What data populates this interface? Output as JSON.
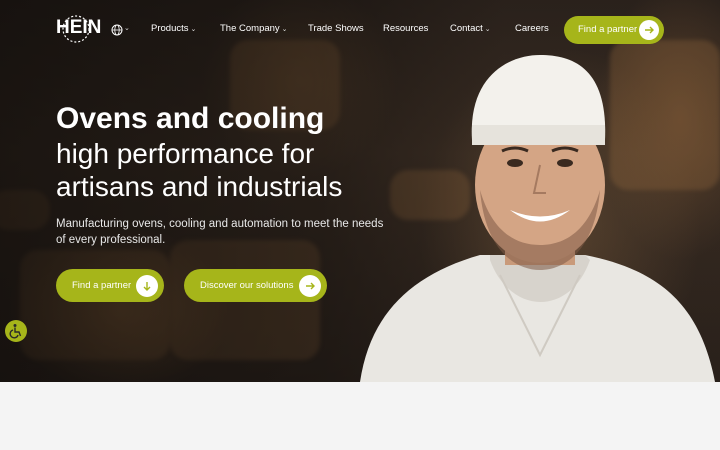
{
  "brand": {
    "logo_text": "HEIN"
  },
  "nav": {
    "language_icon": "globe-icon",
    "items": [
      {
        "label": "Products",
        "has_dropdown": true
      },
      {
        "label": "The Company",
        "has_dropdown": true
      },
      {
        "label": "Trade Shows",
        "has_dropdown": false
      },
      {
        "label": "Resources",
        "has_dropdown": false
      },
      {
        "label": "Contact",
        "has_dropdown": true
      },
      {
        "label": "Careers",
        "has_dropdown": false
      }
    ],
    "cta_label": "Find a partner"
  },
  "hero": {
    "title_bold": "Ovens and cooling",
    "title_line2": "high performance for",
    "title_line3": "artisans and industrials",
    "subtitle": "Manufacturing ovens, cooling and automation to meet the needs of every professional.",
    "primary_button": "Find a partner",
    "secondary_button": "Discover our solutions"
  },
  "colors": {
    "accent": "#a6b51a",
    "text_light": "#ffffff",
    "below_fold_bg": "#f4f4f4"
  },
  "icons": {
    "nav_cta": "arrow-right-icon",
    "primary_button": "arrow-down-icon",
    "secondary_button": "arrow-right-icon",
    "accessibility": "wheelchair-icon"
  }
}
